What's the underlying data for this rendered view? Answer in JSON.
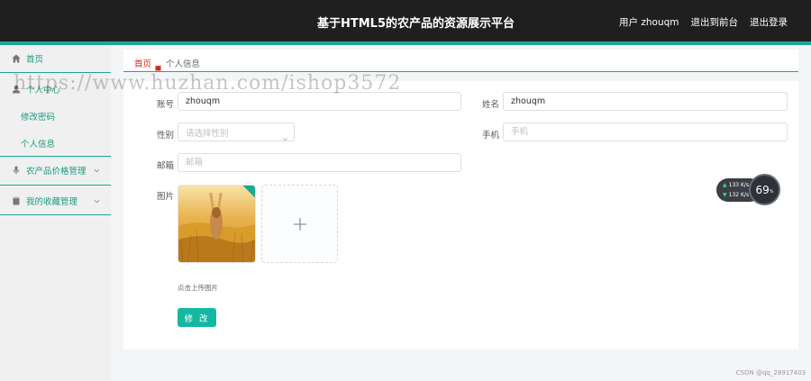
{
  "header": {
    "title": "基于HTML5的农产品的资源展示平台",
    "user_label": "用户 zhouqm",
    "exit_front": "退出到前台",
    "logout": "退出登录"
  },
  "sidebar": {
    "home": "首页",
    "personal_center": "个人中心",
    "change_password": "修改密码",
    "personal_info": "个人信息",
    "price_mgmt": "农产品价格管理",
    "favorites_mgmt": "我的收藏管理"
  },
  "breadcrumb": {
    "home": "首页",
    "current": "个人信息"
  },
  "form": {
    "account_label": "账号",
    "account_value": "zhouqm",
    "name_label": "姓名",
    "name_value": "zhouqm",
    "gender_label": "性别",
    "gender_placeholder": "请选择性别",
    "phone_label": "手机",
    "phone_placeholder": "手机",
    "email_label": "邮箱",
    "email_placeholder": "邮箱",
    "image_label": "图片",
    "upload_hint": "点击上传图片",
    "submit": "修 改"
  },
  "watermark": "https://www.huzhan.com/ishop3572",
  "speed_widget": {
    "up": "133",
    "up_unit": "K/s",
    "down": "132",
    "down_unit": "K/s",
    "percent": "69",
    "percent_unit": "%"
  },
  "credit": "CSDN @qq_28917403",
  "colors": {
    "accent": "#1aa891",
    "header_bg": "#1f1f1f",
    "breadcrumb_home": "#d9281d",
    "button": "#14b8a0"
  }
}
